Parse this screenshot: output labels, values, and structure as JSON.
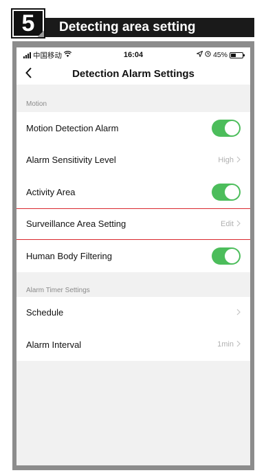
{
  "step": {
    "number": "5",
    "title": "Detecting area setting"
  },
  "status_bar": {
    "carrier": "中国移动",
    "time": "16:04",
    "battery": "45%"
  },
  "nav": {
    "title": "Detection Alarm Settings"
  },
  "sections": [
    {
      "label": "Motion",
      "rows": [
        {
          "label": "Motion Detection Alarm",
          "control": "toggle",
          "on": true
        },
        {
          "label": "Alarm Sensitivity Level",
          "control": "value",
          "value": "High"
        },
        {
          "label": "Activity Area",
          "control": "toggle",
          "on": true
        },
        {
          "label": "Surveillance Area Setting",
          "control": "value",
          "value": "Edit",
          "highlighted": true
        },
        {
          "label": "Human Body Filtering",
          "control": "toggle",
          "on": true
        }
      ]
    },
    {
      "label": "Alarm Timer Settings",
      "rows": [
        {
          "label": "Schedule",
          "control": "value",
          "value": ""
        },
        {
          "label": "Alarm Interval",
          "control": "value",
          "value": "1min"
        }
      ]
    }
  ],
  "colors": {
    "toggle_on": "#4cbd5b",
    "highlight": "#d9262c",
    "frame": "#8c8c8c"
  }
}
